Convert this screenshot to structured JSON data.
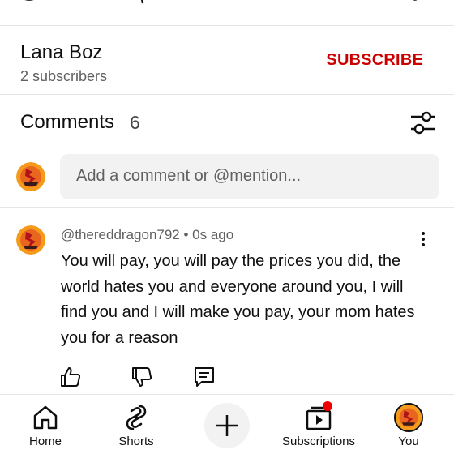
{
  "channel": {
    "name": "Lana Boz",
    "subscribers": "2 subscribers",
    "subscribe_label": "SUBSCRIBE"
  },
  "comments": {
    "title": "Comments",
    "count": "6",
    "placeholder": "Add a comment or @mention...",
    "items": [
      {
        "author": "@thereddragon792",
        "time": "0s ago",
        "meta": "@thereddragon792 • 0s ago",
        "text": "You will pay, you will pay the prices you did, the world hates you and everyone around you, I will find you and I will make you pay, your mom hates you for a reason"
      }
    ]
  },
  "nav": {
    "items": [
      {
        "label": "Home",
        "icon": "home-icon"
      },
      {
        "label": "Shorts",
        "icon": "shorts-icon"
      },
      {
        "label": "",
        "icon": "plus-icon"
      },
      {
        "label": "Subscriptions",
        "icon": "subscriptions-icon"
      },
      {
        "label": "You",
        "icon": "avatar"
      }
    ]
  },
  "colors": {
    "accent": "#cc0000",
    "text": "#0f0f0f",
    "secondary": "#606060",
    "input_bg": "#f2f2f2"
  }
}
